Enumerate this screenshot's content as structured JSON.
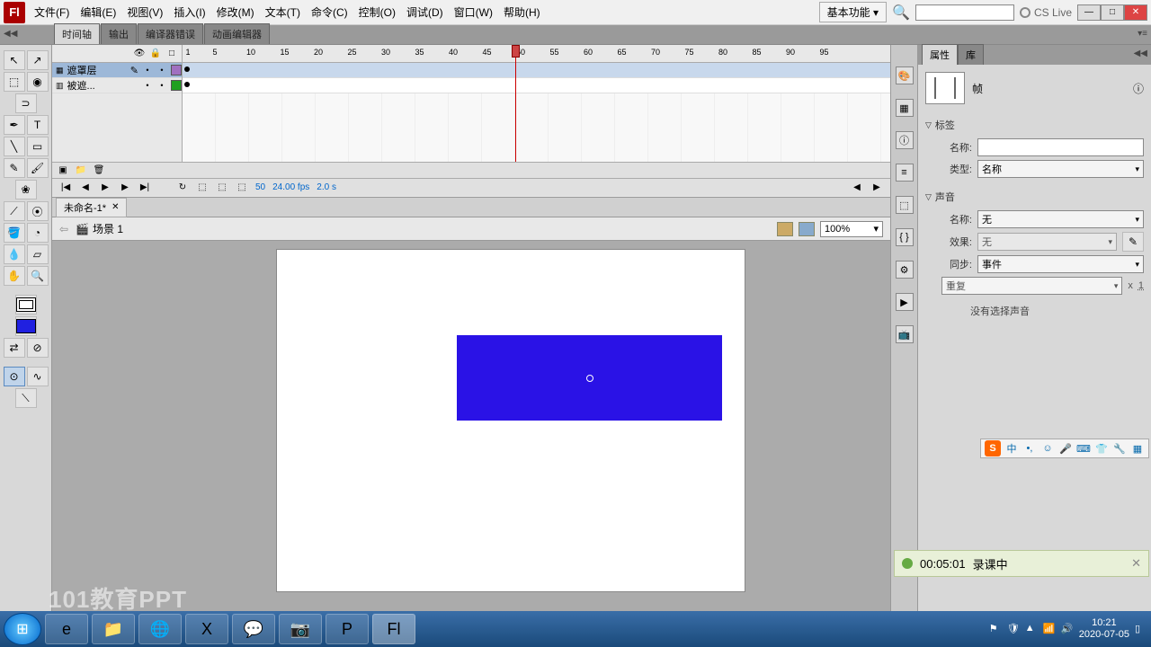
{
  "menubar": {
    "app_icon": "Fl",
    "items": [
      "文件(F)",
      "编辑(E)",
      "视图(V)",
      "插入(I)",
      "修改(M)",
      "文本(T)",
      "命令(C)",
      "控制(O)",
      "调试(D)",
      "窗口(W)",
      "帮助(H)"
    ],
    "workspace": "基本功能",
    "cslive": "CS Live"
  },
  "panel_tabs": [
    "时间轴",
    "输出",
    "编译器错误",
    "动画编辑器"
  ],
  "panel_tab_active": 0,
  "timeline": {
    "ruler_ticks": [
      1,
      5,
      10,
      15,
      20,
      25,
      30,
      35,
      40,
      45,
      50,
      55,
      60,
      65,
      70,
      75,
      80,
      85,
      90,
      95
    ],
    "layers": [
      {
        "name": "遮罩层",
        "selected": true,
        "color": "#a070c0"
      },
      {
        "name": "被遮...",
        "selected": false,
        "color": "#20a020"
      }
    ],
    "playhead_frame": 50,
    "status": {
      "frame": "50",
      "fps": "24.00 fps",
      "time": "2.0 s"
    }
  },
  "doc_tab": {
    "name": "未命名-1*"
  },
  "scene": {
    "label": "场景 1",
    "zoom": "100%"
  },
  "props": {
    "tabs": [
      "属性",
      "库"
    ],
    "tabs_active": 0,
    "type_label": "帧",
    "sect_label": {
      "title": "标签",
      "name_lbl": "名称:",
      "type_lbl": "类型:",
      "type_val": "名称"
    },
    "sect_sound": {
      "title": "声音",
      "name_lbl": "名称:",
      "name_val": "无",
      "effect_lbl": "效果:",
      "effect_val": "无",
      "sync_lbl": "同步:",
      "sync_val": "事件",
      "repeat_val": "重复",
      "repeat_x": "x",
      "repeat_n": "1",
      "info": "没有选择声音"
    }
  },
  "ime": {
    "mode": "中",
    "smile": "☺"
  },
  "recording": {
    "time": "00:05:01",
    "label": "录课中"
  },
  "watermark": "101教育PPT",
  "taskbar": {
    "clock_time": "10:21",
    "clock_date": "2020-07-05"
  }
}
